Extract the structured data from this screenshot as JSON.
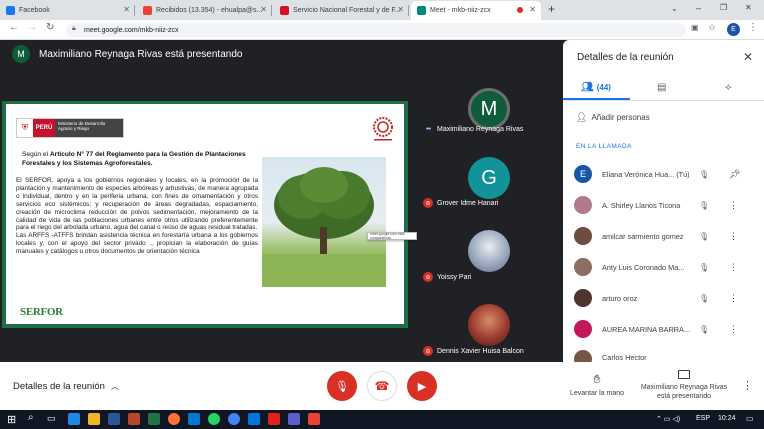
{
  "browser": {
    "tabs": [
      {
        "title": "Facebook",
        "favicon_color": "#1877f2",
        "active": false
      },
      {
        "title": "Recibidos (13.354) - ehualpa@s...",
        "favicon_color": "#ea4335",
        "active": false
      },
      {
        "title": "Servicio Nacional Forestal y de F...",
        "favicon_color": "#d91023",
        "active": false
      },
      {
        "title": "Meet - mkb-niiz-zcx",
        "favicon_color": "#00897b",
        "active": true
      }
    ],
    "new_tab": "+",
    "url": "meet.google.com/mkb-niiz-zcx",
    "profile_initial": "E"
  },
  "meet": {
    "presenter_initial": "M",
    "presenter_banner": "Maximiliano Reynaga Rivas está presentando",
    "slide": {
      "ministry_peru": "PERÚ",
      "ministry_name": "Ministerio de Desarrollo Agrario y Riego",
      "heading_prefix": "Según el ",
      "heading_bold": "Artículo N° 77 del Reglamento para la Gestión de Plantaciones Forestales y los Sistemas Agroforestales.",
      "body": "El SERFOR, apoya a los gobiernos regionales y locales, en la promoción de la plantación y mantenimiento de especies arbóreas y arbustivas, de manera agrupada o individual, dentro y en la periferia urbana, con fines de ornamentación y otros servicios eco sistémicos; y recuperación de áreas degradadas, espaciamiento, creación de microclima reducción de polvos sedimentación, mejoramiento de la calidad de vida de las poblaciones urbanes entre otros utilizando preferentemente para el riego del arbolada urbano, agua del canal o reúso de aguas residual tratadas.\nLas ARFFS -ATFFS brindan asistencia técnica en forestaría urbana a los gobiernos locales y, con el apoyo del sector privado ., propician la elaboración de guías manuales y catálogos u otros documentos de orientación técnica",
      "tooltip": "meet.google.com está compartiendo",
      "footer_logo": "SERFOR"
    },
    "tiles": [
      {
        "name": "Maximiliano Reynaga Rivas",
        "initial": "M",
        "color": "#0f5c3a",
        "muted": false
      },
      {
        "name": "Grover Idme Hanari",
        "initial": "G",
        "color": "#12939a",
        "muted": true
      },
      {
        "name": "Yoissy Pari",
        "initial": "",
        "color": "#7b8fb0",
        "muted": true
      },
      {
        "name": "Dennis Xavier Huisa Balcon",
        "initial": "",
        "color": "#9b3a2e",
        "muted": true
      }
    ]
  },
  "controls": {
    "meeting_details": "Detalles de la reunión",
    "raise_hand": "Levantar la mano",
    "presenting": "Maximiliano Reynaga Rivas está presentando"
  },
  "panel": {
    "title": "Detalles de la reunión",
    "people_count": "(44)",
    "add_people": "Añadir personas",
    "in_call": "EN LA LLAMADA",
    "people": [
      {
        "name": "Eliana Verónica Hua... (Tú)",
        "initial": "E",
        "color": "#1a56a8",
        "pinned": true
      },
      {
        "name": "A. Shirley Llanos Ticona",
        "initial": "",
        "color": "#b07a8c",
        "pinned": false
      },
      {
        "name": "amilcar sarmiento gomez",
        "initial": "",
        "color": "#6d4c41",
        "pinned": false
      },
      {
        "name": "Anty Luis Coronado Ma...",
        "initial": "",
        "color": "#8d6e63",
        "pinned": false
      },
      {
        "name": "arturo oroz",
        "initial": "",
        "color": "#4e342e",
        "pinned": false
      },
      {
        "name": "AUREA MARINA BARRA...",
        "initial": "",
        "color": "#c2185b",
        "pinned": false
      },
      {
        "name": "Carlos Hector",
        "initial": "",
        "color": "#795548",
        "pinned": false
      }
    ]
  },
  "taskbar": {
    "lang": "ESP",
    "time": "10:24"
  }
}
